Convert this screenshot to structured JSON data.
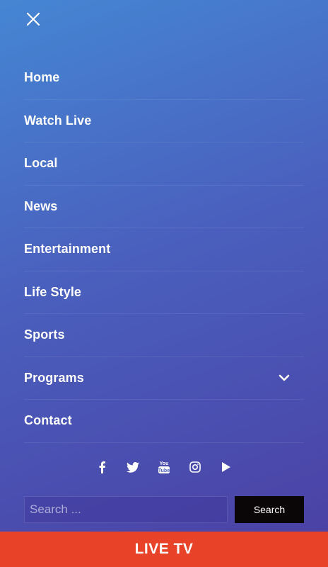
{
  "menu": {
    "items": [
      {
        "label": "Home"
      },
      {
        "label": "Watch Live"
      },
      {
        "label": "Local"
      },
      {
        "label": "News"
      },
      {
        "label": "Entertainment"
      },
      {
        "label": "Life Style"
      },
      {
        "label": "Sports"
      },
      {
        "label": "Programs",
        "has_submenu": true
      },
      {
        "label": "Contact"
      }
    ]
  },
  "social": {
    "icons": [
      "facebook-icon",
      "twitter-icon",
      "youtube-icon",
      "instagram-icon",
      "play-icon"
    ]
  },
  "search": {
    "placeholder": "Search ...",
    "button_label": "Search"
  },
  "live_bar": {
    "label": "LIVE TV"
  },
  "colors": {
    "gradient_start": "#4586d3",
    "gradient_end": "#4b3fa3",
    "live_bar": "#e84328",
    "search_button": "#0a0506"
  }
}
